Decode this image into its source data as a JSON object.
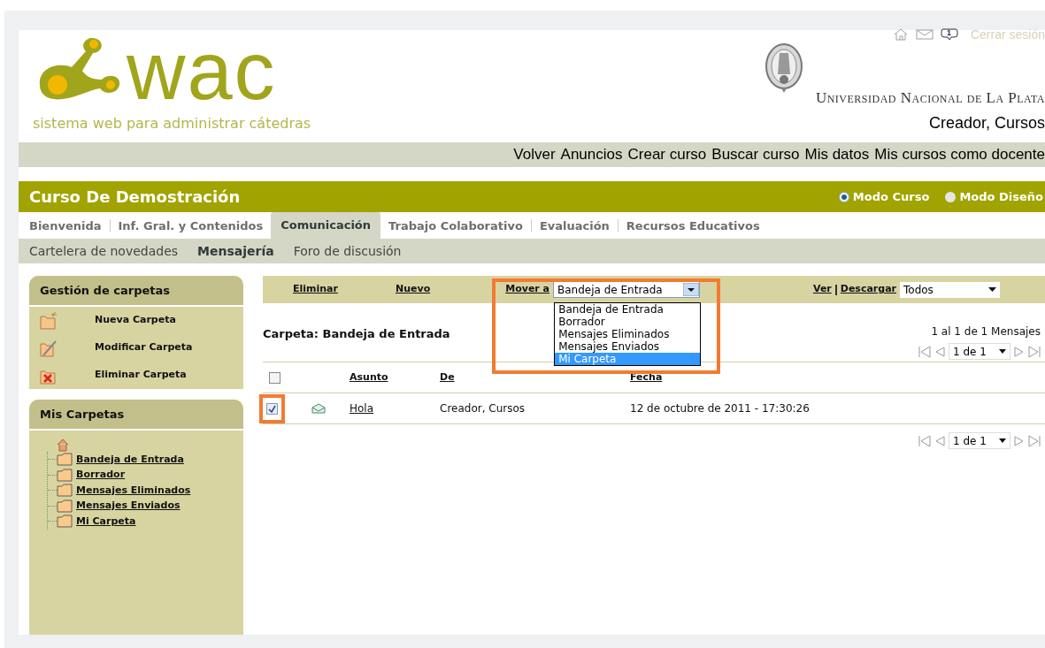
{
  "header": {
    "logo_text": "wac",
    "tagline": "sistema web para administrar cátedras",
    "logout": "Cerrar sesión",
    "message_count": "1",
    "university": "Universidad Nacional de La Plata",
    "user": "Creador, Cursos"
  },
  "top_nav": [
    "Volver",
    "Anuncios",
    "Crear curso",
    "Buscar curso",
    "Mis datos",
    "Mis cursos como docente"
  ],
  "course": {
    "title": "Curso De Demostración",
    "modes": [
      {
        "label": "Modo Curso",
        "selected": true
      },
      {
        "label": "Modo Diseño",
        "selected": false
      }
    ]
  },
  "tabs": [
    {
      "label": "Bienvenida",
      "selected": false
    },
    {
      "label": "Inf. Gral. y Contenidos",
      "selected": false
    },
    {
      "label": "Comunicación",
      "selected": true
    },
    {
      "label": "Trabajo Colaborativo",
      "selected": false
    },
    {
      "label": "Evaluación",
      "selected": false
    },
    {
      "label": "Recursos Educativos",
      "selected": false
    }
  ],
  "subtabs": [
    {
      "label": "Cartelera de novedades",
      "selected": false
    },
    {
      "label": "Mensajería",
      "selected": true
    },
    {
      "label": "Foro de discusión",
      "selected": false
    }
  ],
  "sidebar": {
    "folder_management": {
      "title": "Gestión de carpetas",
      "items": [
        {
          "kind": "new",
          "label": "Nueva Carpeta"
        },
        {
          "kind": "edit",
          "label": "Modificar Carpeta"
        },
        {
          "kind": "delete",
          "label": "Eliminar Carpeta"
        }
      ]
    },
    "my_folders": {
      "title": "Mis Carpetas",
      "folders": [
        "Bandeja de Entrada",
        "Borrador",
        "Mensajes Eliminados",
        "Mensajes Enviados",
        "Mi Carpeta"
      ]
    }
  },
  "toolbar": {
    "delete": "Eliminar",
    "new": "Nuevo",
    "move_label": "Mover a",
    "move_value": "Bandeja de Entrada",
    "move_options": [
      {
        "label": "Bandeja de Entrada",
        "selected": false
      },
      {
        "label": "Borrador",
        "selected": false
      },
      {
        "label": "Mensajes Eliminados",
        "selected": false
      },
      {
        "label": "Mensajes Enviados",
        "selected": false
      },
      {
        "label": "Mi Carpeta",
        "selected": true
      }
    ],
    "view": "Ver",
    "download": "Descargar",
    "filter_value": "Todos"
  },
  "folder_title": "Carpeta: Bandeja de Entrada",
  "count": "1 al 1 de 1 Mensajes",
  "pager_top": "1 de 1",
  "pager_bottom": "1 de 1",
  "table": {
    "columns": [
      "Asunto",
      "De",
      "Fecha"
    ],
    "select_all_checked": false,
    "rows": [
      {
        "checked": true,
        "subject": "Hola",
        "from": "Creador, Cursos",
        "date": "12 de octubre de 2011 - 17:30:26"
      }
    ]
  }
}
